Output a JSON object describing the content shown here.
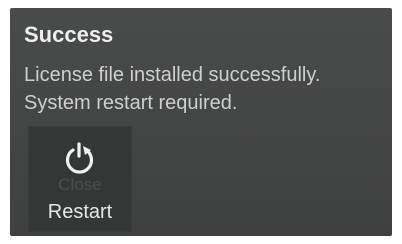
{
  "dialog": {
    "title": "Success",
    "message_line1": "License file installed successfully.",
    "message_line2": "System restart required."
  },
  "buttons": {
    "restart_label": "Restart",
    "restart_icon": "restart-icon",
    "ghost_label": "Close"
  },
  "colors": {
    "dialog_bg": "#464747",
    "text_primary": "#eeeeee",
    "text_secondary": "#cfcfcf",
    "button_bg": "#353636"
  }
}
